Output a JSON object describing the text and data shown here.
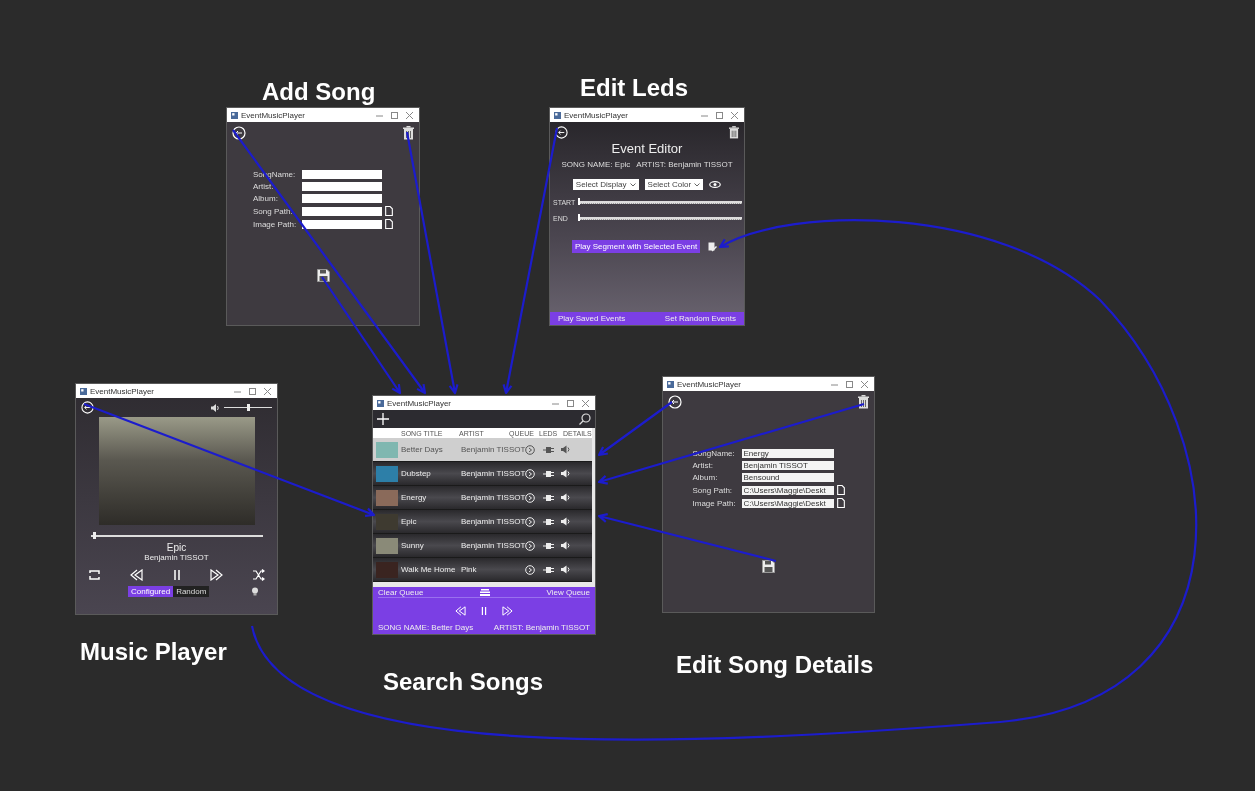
{
  "screens": [
    {
      "kind": "add_song",
      "caption": "Add Song",
      "window_title": "EventMusicPlayer",
      "fields": [
        {
          "label": "SongName:",
          "browse": false
        },
        {
          "label": "Artist:",
          "browse": false
        },
        {
          "label": "Album:",
          "browse": false
        },
        {
          "label": "Song Path:",
          "browse": true
        },
        {
          "label": "Image Path:",
          "browse": true
        }
      ]
    },
    {
      "kind": "event_editor",
      "caption": "Edit Leds",
      "window_title": "EventMusicPlayer",
      "heading": "Event Editor",
      "song_info": "SONG NAME: Epic",
      "artist_info": "ARTIST: Benjamin TISSOT",
      "selects": [
        {
          "value": "Select Display"
        },
        {
          "value": "Select Color"
        }
      ],
      "sliders": [
        {
          "label": "START",
          "level": 0
        },
        {
          "label": "END",
          "level": 0
        }
      ],
      "play_button": "Play Segment with Selected Event",
      "bottom_buttons": [
        "Play Saved Events",
        "Set Random Events"
      ]
    },
    {
      "kind": "music_player",
      "caption": "Music Player",
      "window_title": "EventMusicPlayer",
      "volume": {
        "level": 0.5
      },
      "progress": {
        "level": 0.02
      },
      "song": "Epic",
      "artist": "Benjamin TISSOT",
      "modes": [
        {
          "label": "Configured",
          "selected": true
        },
        {
          "label": "Random",
          "selected": false
        }
      ]
    },
    {
      "kind": "song_list",
      "caption": "Search Songs",
      "window_title": "EventMusicPlayer",
      "columns": [
        "SONG TITLE",
        "ARTIST",
        "QUEUE",
        "LEDS",
        "DETAILS"
      ],
      "rows": [
        {
          "title": "Better Days",
          "artist": "Benjamin TISSOT",
          "selected": true
        },
        {
          "title": "Dubstep",
          "artist": "Benjamin TISSOT",
          "selected": false
        },
        {
          "title": "Energy",
          "artist": "Benjamin TISSOT",
          "selected": false
        },
        {
          "title": "Epic",
          "artist": "Benjamin TISSOT",
          "selected": false
        },
        {
          "title": "Sunny",
          "artist": "Benjamin TISSOT",
          "selected": false
        },
        {
          "title": "Walk Me Home",
          "artist": "Pink",
          "selected": false
        }
      ],
      "clear_queue": "Clear Queue",
      "view_queue": "View Queue",
      "now_playing": "SONG NAME: Better Days",
      "now_artist": "ARTIST:  Benjamin TISSOT"
    },
    {
      "kind": "song_details",
      "caption": "Edit Song Details",
      "window_title": "EventMusicPlayer",
      "fields": [
        {
          "label": "SongName:",
          "value": "Energy",
          "browse": false
        },
        {
          "label": "Artist:",
          "value": "Benjamin TISSOT",
          "browse": false
        },
        {
          "label": "Album:",
          "value": "Bensound",
          "browse": false
        },
        {
          "label": "Song Path:",
          "value": "C:\\Users\\Maggie\\Deskt",
          "browse": true
        },
        {
          "label": "Image Path:",
          "value": "C:\\Users\\Maggie\\Deskt",
          "browse": true
        }
      ]
    }
  ]
}
